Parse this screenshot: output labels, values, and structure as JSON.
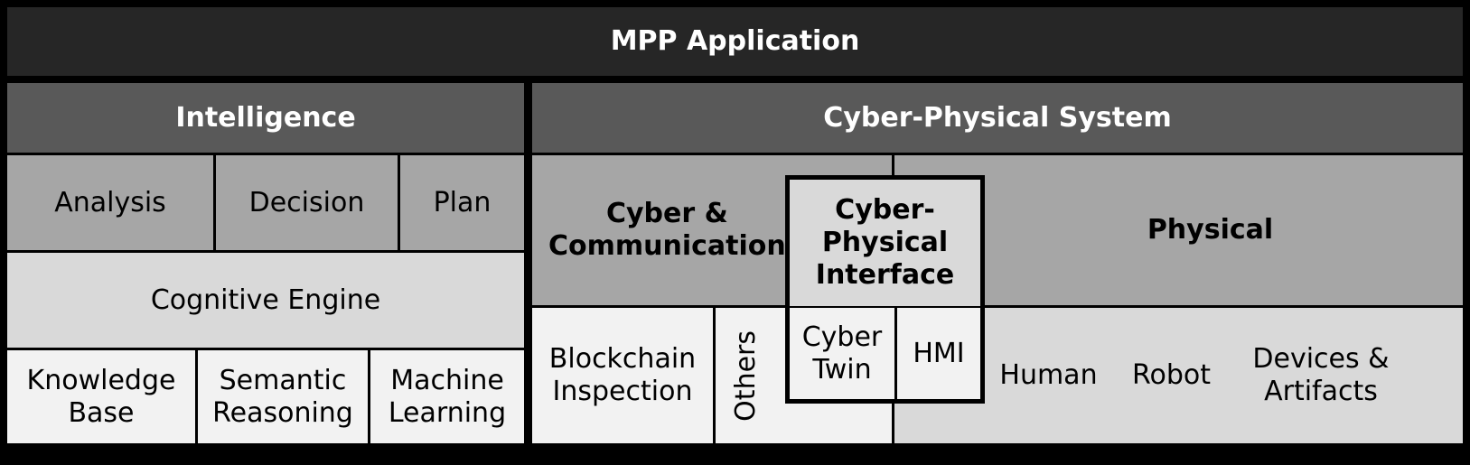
{
  "top": {
    "title": "MPP Application"
  },
  "intelligence": {
    "title": "Intelligence",
    "row1": [
      "Analysis",
      "Decision",
      "Plan"
    ],
    "engine": "Cognitive Engine",
    "row3": [
      "Knowledge\nBase",
      "Semantic\nReasoning",
      "Machine\nLearning"
    ]
  },
  "cps": {
    "title": "Cyber-Physical System",
    "cyber_comm": "Cyber &\nCommunication",
    "interface": "Cyber-\nPhysical\nInterface",
    "physical": "Physical",
    "blockchain": "Blockchain\nInspection",
    "others": "Others",
    "cyber_twin": "Cyber\nTwin",
    "hmi": "HMI",
    "human": "Human",
    "robot": "Robot",
    "devices": "Devices &\nArtifacts"
  }
}
